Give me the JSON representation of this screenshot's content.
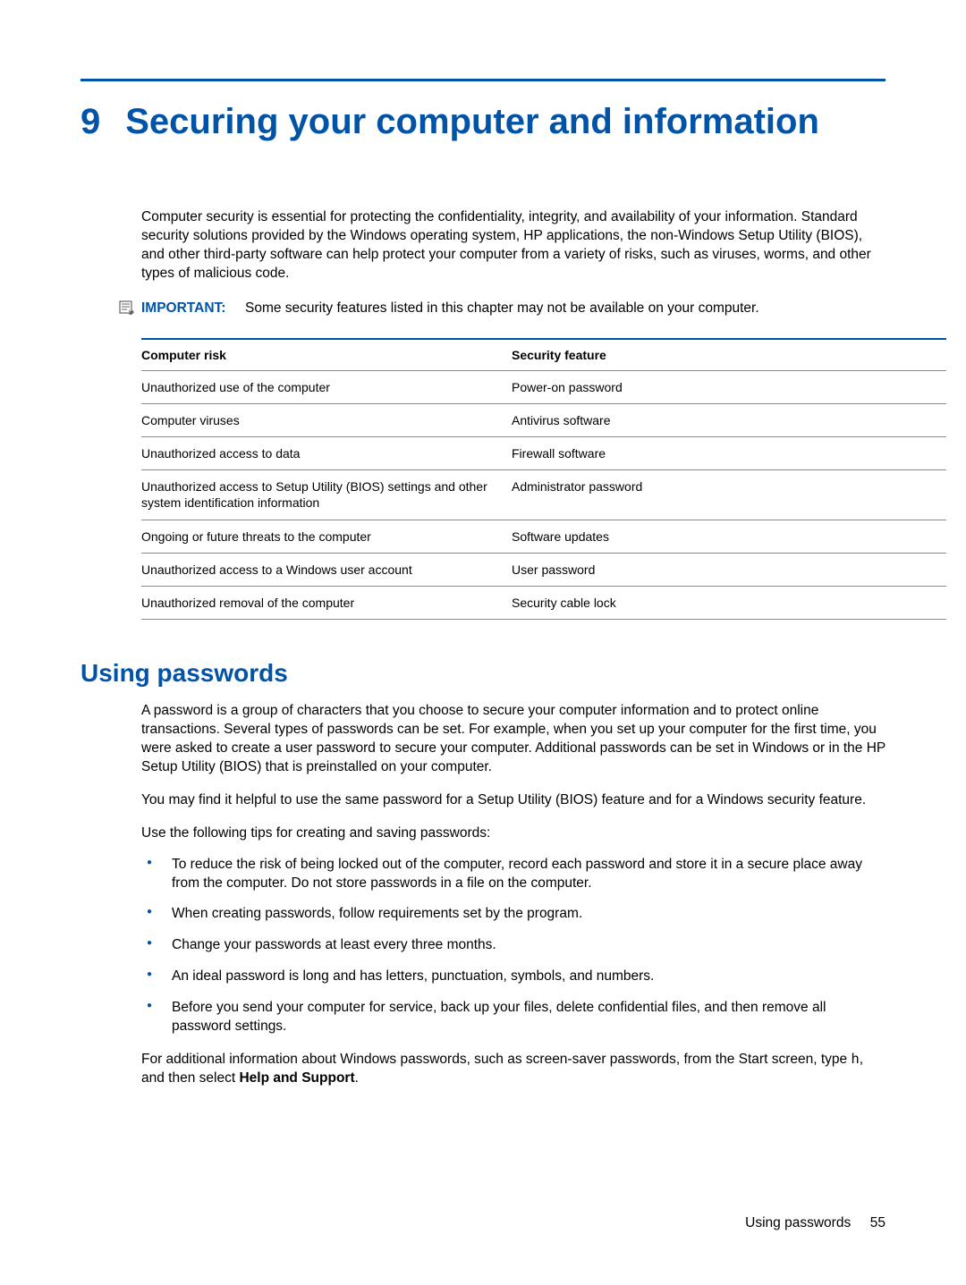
{
  "chapter": {
    "number": "9",
    "title": "Securing your computer and information"
  },
  "intro": "Computer security is essential for protecting the confidentiality, integrity, and availability of your information. Standard security solutions provided by the Windows operating system, HP applications, the non-Windows Setup Utility (BIOS), and other third-party software can help protect your computer from a variety of risks, such as viruses, worms, and other types of malicious code.",
  "note": {
    "label": "IMPORTANT:",
    "text": "Some security features listed in this chapter may not be available on your computer."
  },
  "table": {
    "headers": {
      "col1": "Computer risk",
      "col2": "Security feature"
    },
    "rows": [
      {
        "risk": "Unauthorized use of the computer",
        "feature": "Power-on password"
      },
      {
        "risk": "Computer viruses",
        "feature": "Antivirus software"
      },
      {
        "risk": "Unauthorized access to data",
        "feature": "Firewall software"
      },
      {
        "risk": "Unauthorized access to Setup Utility (BIOS) settings and other system identification information",
        "feature": "Administrator password"
      },
      {
        "risk": "Ongoing or future threats to the computer",
        "feature": "Software updates"
      },
      {
        "risk": "Unauthorized access to a Windows user account",
        "feature": "User password"
      },
      {
        "risk": "Unauthorized removal of the computer",
        "feature": "Security cable lock"
      }
    ]
  },
  "section": {
    "title": "Using passwords"
  },
  "para1": "A password is a group of characters that you choose to secure your computer information and to protect online transactions. Several types of passwords can be set. For example, when you set up your computer for the first time, you were asked to create a user password to secure your computer. Additional passwords can be set in Windows or in the HP Setup Utility (BIOS) that is preinstalled on your computer.",
  "para2": "You may find it helpful to use the same password for a Setup Utility (BIOS) feature and for a Windows security feature.",
  "para3": "Use the following tips for creating and saving passwords:",
  "tips": [
    "To reduce the risk of being locked out of the computer, record each password and store it in a secure place away from the computer. Do not store passwords in a file on the computer.",
    "When creating passwords, follow requirements set by the program.",
    "Change your passwords at least every three months.",
    "An ideal password is long and has letters, punctuation, symbols, and numbers.",
    "Before you send your computer for service, back up your files, delete confidential files, and then remove all password settings."
  ],
  "para4_prefix": "For additional information about Windows passwords, such as screen-saver passwords, from the Start screen, type ",
  "para4_code": "h",
  "para4_mid": ", and then select ",
  "para4_bold": "Help and Support",
  "para4_suffix": ".",
  "footer": {
    "text": "Using passwords",
    "page": "55"
  }
}
